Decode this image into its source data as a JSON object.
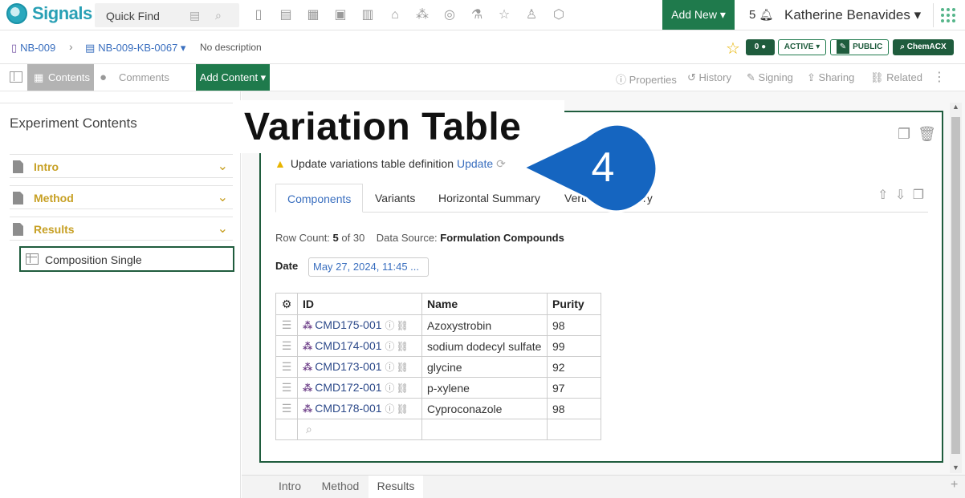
{
  "app": {
    "logo_text": "Signals",
    "quick_find": "Quick Find",
    "add_new": "Add New ▾",
    "notification_count": "5",
    "user_name": "Katherine Benavides ▾"
  },
  "breadcrumb": {
    "notebook": "NB-009",
    "experiment": "NB-009-KB-0067 ▾",
    "description": "No description",
    "comment_count": "0",
    "status": "ACTIVE ▾",
    "visibility": "PUBLIC",
    "chemacx": "ChemACX"
  },
  "toolbar": {
    "contents": "Contents",
    "comments": "Comments",
    "add_content": "Add Content ▾",
    "properties": "Properties",
    "history": "History",
    "signing": "Signing",
    "sharing": "Sharing",
    "related": "Related"
  },
  "left_panel": {
    "title": "Experiment Contents",
    "sections": [
      "Intro",
      "Method",
      "Results"
    ],
    "selected_item": "Composition Single"
  },
  "overlay": {
    "title": "Variation Table",
    "callout_number": "4"
  },
  "warning": {
    "text": "Update variations table definition",
    "link": "Update"
  },
  "tabs": [
    "Components",
    "Variants",
    "Horizontal Summary",
    "Vertical Summary"
  ],
  "summary": {
    "row_count_label": "Row Count:",
    "row_count_value": "5",
    "row_count_of": "of 30",
    "data_source_label": "Data Source:",
    "data_source_value": "Formulation Compounds",
    "date_label": "Date",
    "date_value": "May 27, 2024, 11:45 ..."
  },
  "table": {
    "headers": [
      "ID",
      "Name",
      "Purity"
    ],
    "rows": [
      {
        "id": "CMD175-001",
        "name": "Azoxystrobin",
        "purity": "98"
      },
      {
        "id": "CMD174-001",
        "name": "sodium dodecyl sulfate",
        "purity": "99"
      },
      {
        "id": "CMD173-001",
        "name": "glycine",
        "purity": "92"
      },
      {
        "id": "CMD172-001",
        "name": "p-xylene",
        "purity": "97"
      },
      {
        "id": "CMD178-001",
        "name": "Cyproconazole",
        "purity": "98"
      }
    ]
  },
  "bottom_tabs": [
    "Intro",
    "Method",
    "Results"
  ],
  "colors": {
    "brand_green": "#1f7a4c",
    "accent_blue": "#3a6fbf",
    "section_gold": "#c7a024",
    "callout_blue": "#1565c0"
  }
}
